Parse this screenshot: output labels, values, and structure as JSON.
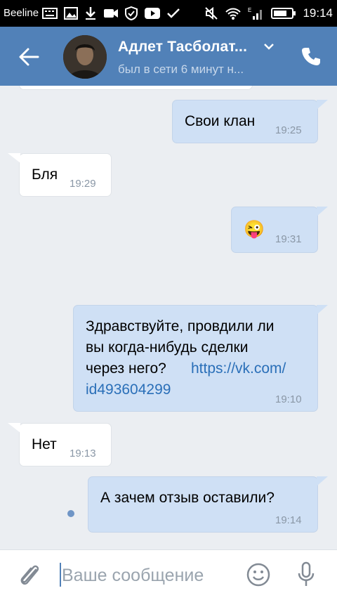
{
  "status_bar": {
    "carrier": "Beeline",
    "time": "19:14"
  },
  "header": {
    "contact_name": "Адлет Тасболат...",
    "last_seen": "был в сети 6 минут н..."
  },
  "messages": [
    {
      "direction": "out",
      "text": "Свои клан",
      "time": "19:25"
    },
    {
      "direction": "in",
      "text": "Бля",
      "time": "19:29"
    },
    {
      "direction": "out",
      "text": "😜",
      "time": "19:31"
    },
    {
      "direction": "out",
      "lines": [
        "Здравствуйте, провдили ли",
        "вы когда-нибудь сделки",
        "через него?"
      ],
      "link_part1": "https://vk.com/",
      "link_part2": "id493604299",
      "time": "19:10"
    },
    {
      "direction": "in",
      "text": "Нет",
      "time": "19:13"
    },
    {
      "direction": "out",
      "text": "А зачем отзыв оставили?",
      "time": "19:14",
      "unread": true
    }
  ],
  "composer": {
    "placeholder": "Ваше сообщение"
  },
  "colors": {
    "header": "#5181b8",
    "outgoing_bubble": "#cfe0f5",
    "incoming_bubble": "#ffffff",
    "background": "#ebeef2",
    "link": "#2a6fb8"
  }
}
